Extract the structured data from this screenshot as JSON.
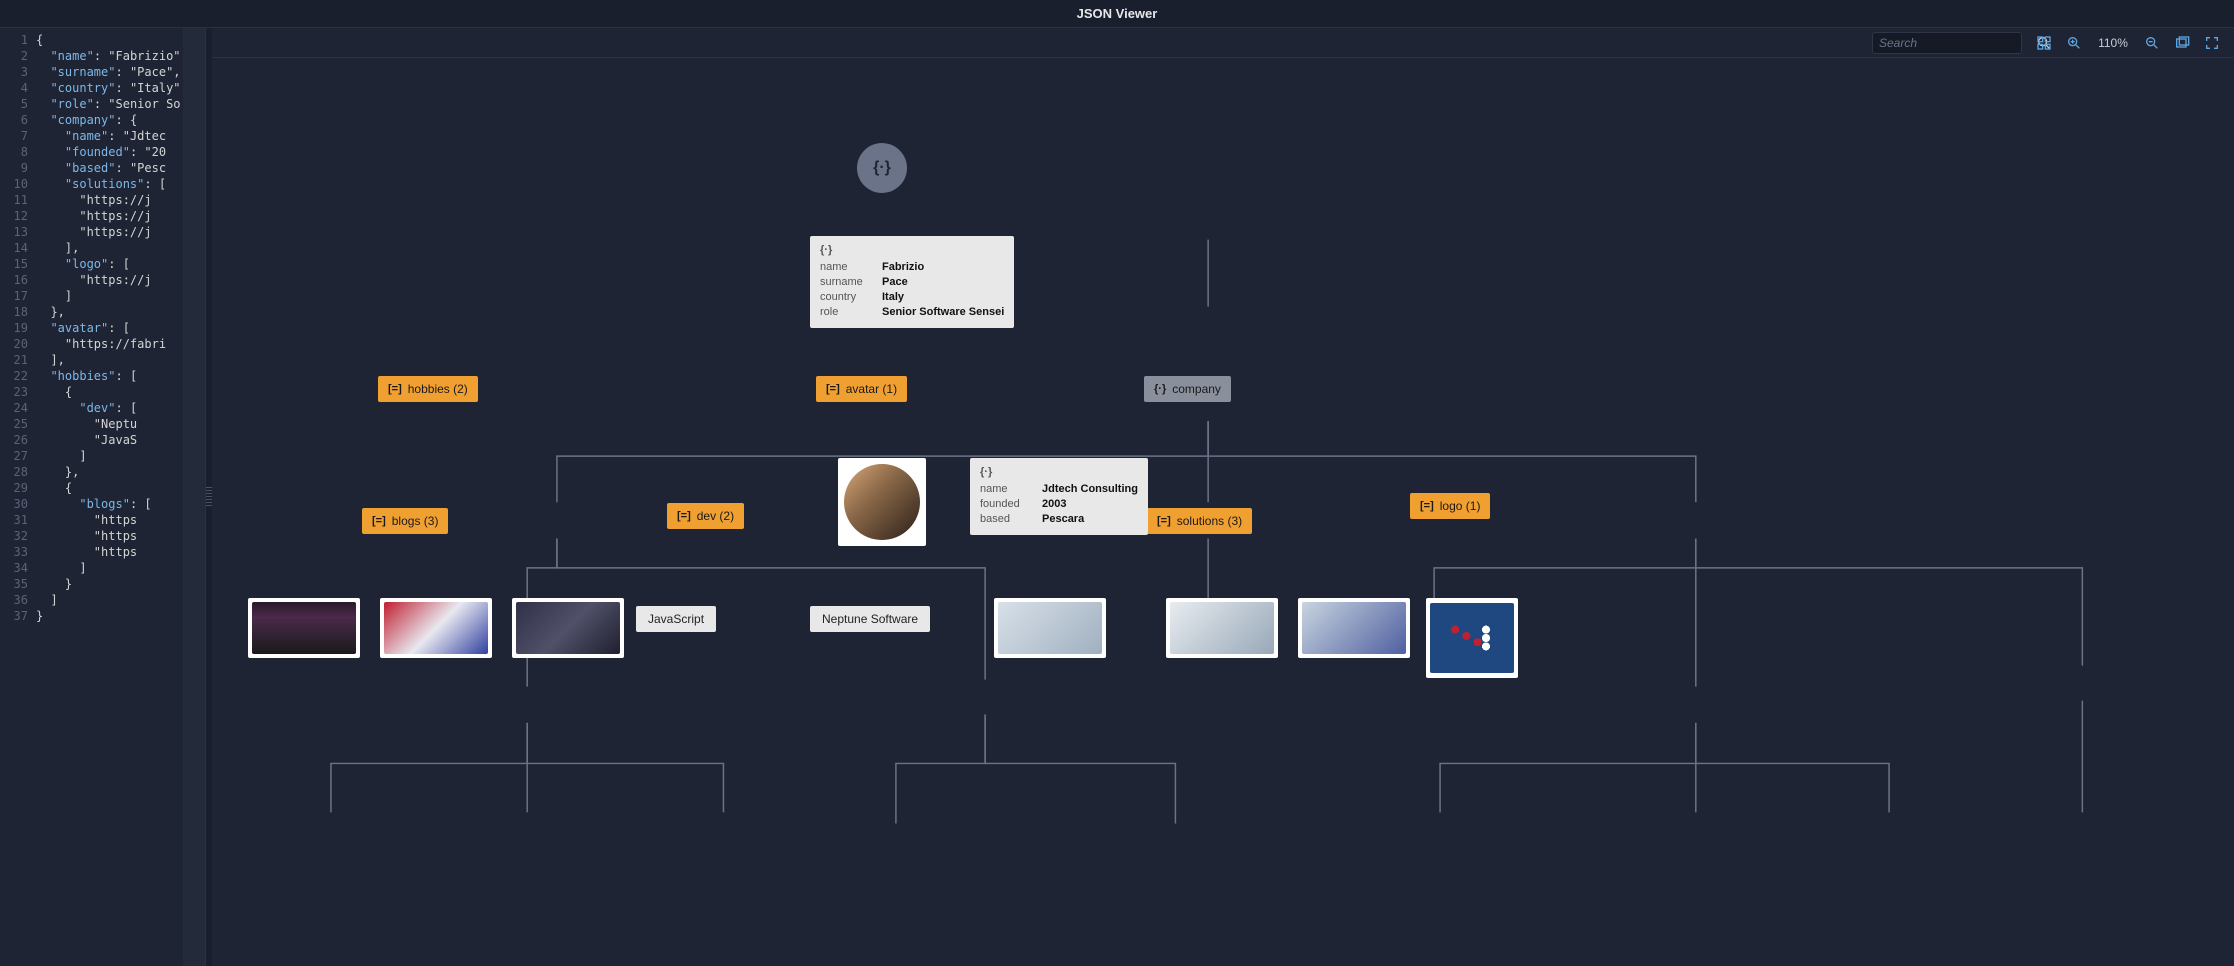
{
  "app": {
    "title": "JSON Viewer"
  },
  "toolbar": {
    "search_placeholder": "Search",
    "zoom": "110%"
  },
  "editor": {
    "lines": [
      "{",
      "  \"name\": \"Fabrizio\"",
      "  \"surname\": \"Pace\",",
      "  \"country\": \"Italy\"",
      "  \"role\": \"Senior So",
      "  \"company\": {",
      "    \"name\": \"Jdtec",
      "    \"founded\": \"20",
      "    \"based\": \"Pesc",
      "    \"solutions\": [",
      "      \"https://j",
      "      \"https://j",
      "      \"https://j",
      "    ],",
      "    \"logo\": [",
      "      \"https://j",
      "    ]",
      "  },",
      "  \"avatar\": [",
      "    \"https://fabri",
      "  ],",
      "  \"hobbies\": [",
      "    {",
      "      \"dev\": [",
      "        \"Neptu",
      "        \"JavaS",
      "      ]",
      "    },",
      "    {",
      "      \"blogs\": [",
      "        \"https",
      "        \"https",
      "        \"https",
      "      ]",
      "    }",
      "  ]",
      "}"
    ]
  },
  "tree": {
    "root_glyph": "{·}",
    "main_obj": {
      "head": "{·}",
      "rows": [
        {
          "k": "name",
          "v": "Fabrizio"
        },
        {
          "k": "surname",
          "v": "Pace"
        },
        {
          "k": "country",
          "v": "Italy"
        },
        {
          "k": "role",
          "v": "Senior Software Sensei"
        }
      ]
    },
    "hobbies_label": "hobbies (2)",
    "avatar_label": "avatar (1)",
    "company_label": "company",
    "blogs_label": "blogs (3)",
    "dev_label": "dev (2)",
    "solutions_label": "solutions (3)",
    "logo_label": "logo (1)",
    "company_obj": {
      "head": "{·}",
      "rows": [
        {
          "k": "name",
          "v": "Jdtech Consulting"
        },
        {
          "k": "founded",
          "v": "2003"
        },
        {
          "k": "based",
          "v": "Pescara"
        }
      ]
    },
    "leaf_js": "JavaScript",
    "leaf_neptune": "Neptune Software",
    "array_glyph": "[=]",
    "object_glyph": "{·}"
  }
}
